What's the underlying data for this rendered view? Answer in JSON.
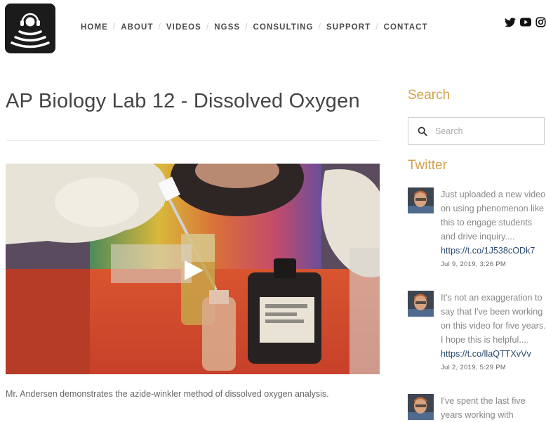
{
  "nav": {
    "items": [
      {
        "label": "HOME"
      },
      {
        "label": "ABOUT"
      },
      {
        "label": "VIDEOS"
      },
      {
        "label": "NGSS"
      },
      {
        "label": "CONSULTING"
      },
      {
        "label": "SUPPORT"
      },
      {
        "label": "CONTACT"
      }
    ],
    "separator": "/"
  },
  "social": [
    "twitter-icon",
    "youtube-icon",
    "instagram-icon"
  ],
  "article": {
    "title": "AP Biology Lab 12 - Dissolved Oxygen",
    "caption": "Mr. Andersen demonstrates the azide-winkler method of dissolved oxygen analysis."
  },
  "sidebar": {
    "search_heading": "Search",
    "search_placeholder": "Search",
    "twitter_heading": "Twitter",
    "tweets": [
      {
        "text": "Just uploaded a new video on using phenomenon like this to engage students and drive inquiry....",
        "link": "https://t.co/1J538cODk7",
        "date": "Jul 9, 2019, 3:26 PM"
      },
      {
        "text": "It's not an exaggeration to say that I've been working on this video for five years. I hope this is helpful....",
        "link": "https://t.co/llaQTTXvVv",
        "date": "Jul 2, 2019, 5:29 PM"
      },
      {
        "text": "I've spent the last five years working with",
        "link": "",
        "date": ""
      }
    ]
  },
  "colors": {
    "accent": "#d1a24d",
    "link": "#2b4a6f",
    "logo_bg": "#1b1b1b"
  }
}
